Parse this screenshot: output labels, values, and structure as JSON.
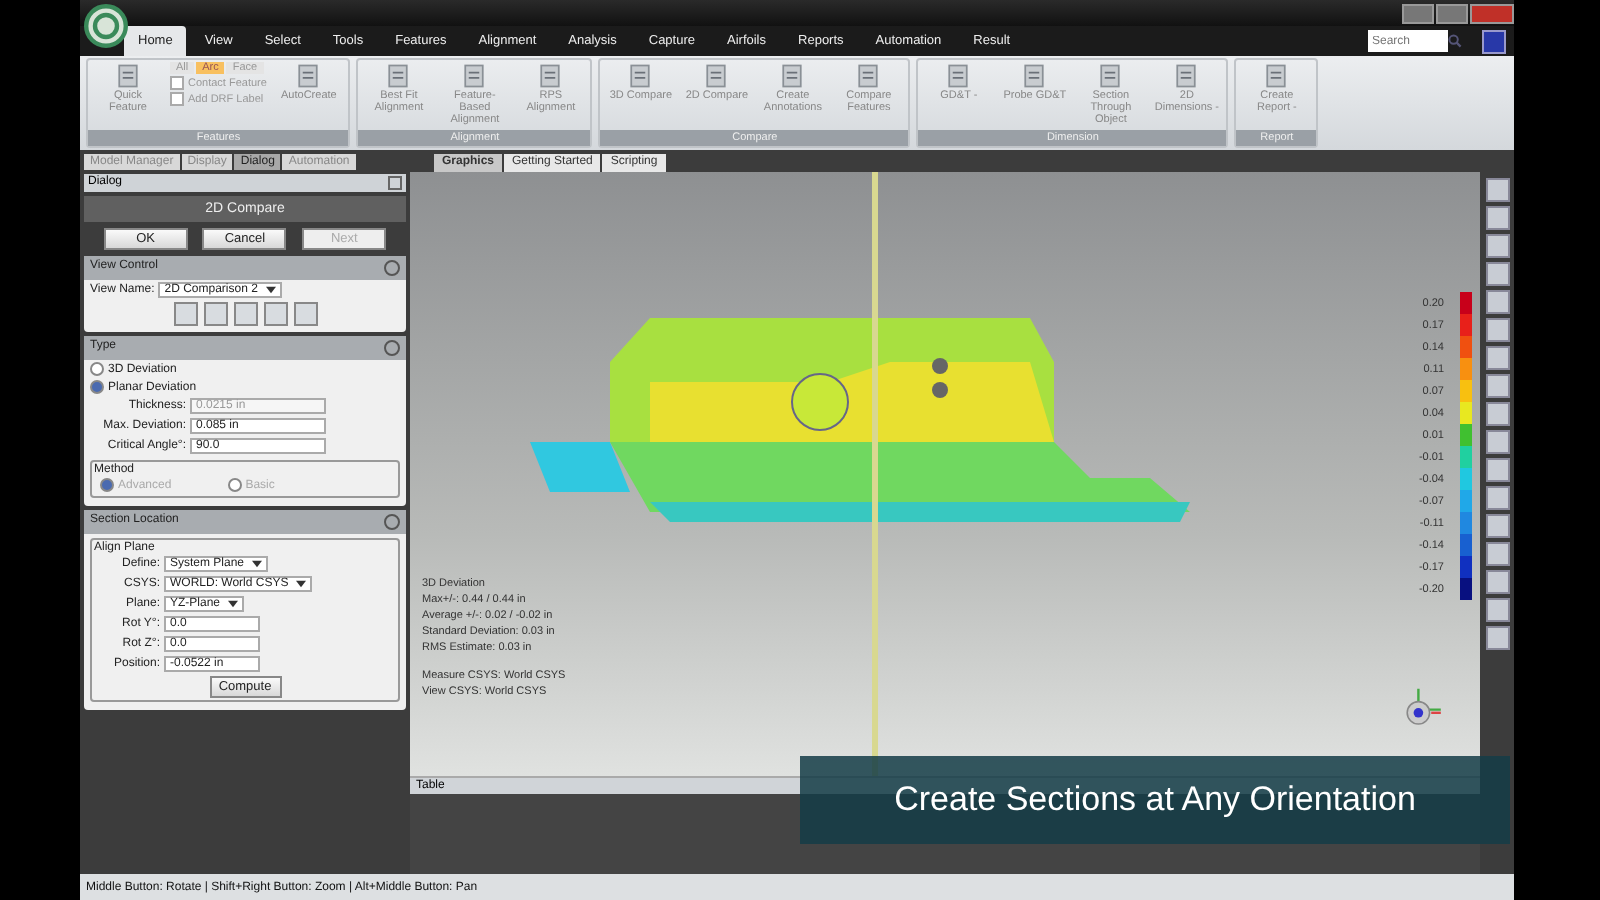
{
  "app_tabs": [
    {
      "label": "Home",
      "selected": true
    },
    {
      "label": "View",
      "selected": false
    },
    {
      "label": "Select",
      "selected": false
    },
    {
      "label": "Tools",
      "selected": false
    },
    {
      "label": "Features",
      "selected": false
    },
    {
      "label": "Alignment",
      "selected": false
    },
    {
      "label": "Analysis",
      "selected": false
    },
    {
      "label": "Capture",
      "selected": false
    },
    {
      "label": "Airfoils",
      "selected": false
    },
    {
      "label": "Reports",
      "selected": false
    },
    {
      "label": "Automation",
      "selected": false
    },
    {
      "label": "Result",
      "selected": false
    }
  ],
  "search": {
    "placeholder": "Search"
  },
  "ribbon_groups": [
    {
      "title": "Features",
      "items": [
        {
          "kind": "button",
          "label": "Quick Feature"
        },
        {
          "kind": "stack",
          "toggles": [
            {
              "label": "All",
              "selected": false
            },
            {
              "label": "Arc",
              "selected": true
            },
            {
              "label": "Face",
              "selected": false
            }
          ],
          "checks": [
            {
              "label": "Contact Feature",
              "checked": false
            },
            {
              "label": "Add DRF Label",
              "checked": false
            }
          ]
        },
        {
          "kind": "button",
          "label": "AutoCreate"
        }
      ]
    },
    {
      "title": "Alignment",
      "items": [
        {
          "kind": "button",
          "label": "Best Fit Alignment"
        },
        {
          "kind": "button",
          "label": "Feature-Based Alignment"
        },
        {
          "kind": "button",
          "label": "RPS Alignment"
        }
      ]
    },
    {
      "title": "Compare",
      "items": [
        {
          "kind": "button",
          "label": "3D Compare"
        },
        {
          "kind": "button",
          "label": "2D Compare"
        },
        {
          "kind": "button",
          "label": "Create Annotations"
        },
        {
          "kind": "button",
          "label": "Compare Features"
        }
      ]
    },
    {
      "title": "Dimension",
      "items": [
        {
          "kind": "button",
          "label": "GD&T -"
        },
        {
          "kind": "button",
          "label": "Probe GD&T"
        },
        {
          "kind": "button",
          "label": "Section Through Object"
        },
        {
          "kind": "button",
          "label": "2D Dimensions -"
        }
      ]
    },
    {
      "title": "Report",
      "items": [
        {
          "kind": "button",
          "label": "Create Report -"
        }
      ]
    }
  ],
  "panel_tabs": [
    {
      "label": "Model Manager",
      "selected": false
    },
    {
      "label": "Display",
      "selected": false
    },
    {
      "label": "Dialog",
      "selected": true
    },
    {
      "label": "Automation",
      "selected": false
    }
  ],
  "dialog": {
    "header": "Dialog",
    "title": "2D Compare",
    "buttons": [
      {
        "label": "OK",
        "disabled": false
      },
      {
        "label": "Cancel",
        "disabled": false
      },
      {
        "label": "Next",
        "disabled": true
      }
    ],
    "view_control": {
      "title": "View Control",
      "label": "View Name:",
      "value": "2D Comparison 2"
    },
    "type": {
      "title": "Type",
      "options": [
        {
          "label": "3D Deviation",
          "selected": false
        },
        {
          "label": "Planar Deviation",
          "selected": true
        }
      ],
      "fields": [
        {
          "label": "Thickness:",
          "value": "0.0215 in",
          "disabled": true
        },
        {
          "label": "Max. Deviation:",
          "value": "0.085 in",
          "disabled": false
        },
        {
          "label": "Critical Angle°:",
          "value": "90.0",
          "disabled": false
        }
      ],
      "method": {
        "title": "Method",
        "options": [
          {
            "label": "Advanced",
            "selected": true
          },
          {
            "label": "Basic",
            "selected": false
          }
        ]
      }
    },
    "section_location": {
      "title": "Section Location",
      "group": "Align Plane",
      "fields": [
        {
          "kind": "dropdown",
          "label": "Define:",
          "value": "System Plane"
        },
        {
          "kind": "dropdown",
          "label": "CSYS:",
          "value": "WORLD: World CSYS"
        },
        {
          "kind": "dropdown",
          "label": "Plane:",
          "value": "YZ-Plane"
        },
        {
          "kind": "spin",
          "label": "Rot Y°:",
          "value": "0.0"
        },
        {
          "kind": "spin",
          "label": "Rot Z°:",
          "value": "0.0"
        },
        {
          "kind": "spin",
          "label": "Position:",
          "value": "-0.0522 in"
        }
      ],
      "button": "Compute"
    }
  },
  "doc_tabs": [
    {
      "label": "Graphics",
      "selected": true
    },
    {
      "label": "Getting Started",
      "selected": false
    },
    {
      "label": "Scripting",
      "selected": false
    }
  ],
  "stats": [
    "3D Deviation",
    "Max+/-: 0.44 / 0.44 in",
    "Average +/-: 0.02 / -0.02 in",
    "Standard Deviation: 0.03 in",
    "RMS Estimate: 0.03 in"
  ],
  "csys": [
    "Measure CSYS: World CSYS",
    "View CSYS: World CSYS"
  ],
  "legend": [
    {
      "label": "0.20",
      "color": "#c8001a"
    },
    {
      "label": "0.17",
      "color": "#e8201a"
    },
    {
      "label": "0.14",
      "color": "#f05010"
    },
    {
      "label": "0.11",
      "color": "#f89010"
    },
    {
      "label": "0.07",
      "color": "#f8c010"
    },
    {
      "label": "0.04",
      "color": "#e8e820"
    },
    {
      "label": "0.01",
      "color": "#40c030"
    },
    {
      "label": "-0.01",
      "color": "#20d0a0"
    },
    {
      "label": "-0.04",
      "color": "#20c8e0"
    },
    {
      "label": "-0.07",
      "color": "#20a8e8"
    },
    {
      "label": "-0.11",
      "color": "#2088e0"
    },
    {
      "label": "-0.14",
      "color": "#1860d0"
    },
    {
      "label": "-0.17",
      "color": "#1030c0"
    },
    {
      "label": "-0.20",
      "color": "#081080"
    }
  ],
  "table_panel": {
    "title": "Table"
  },
  "caption": "Create Sections at Any Orientation",
  "status_bar": "Middle Button: Rotate | Shift+Right Button: Zoom | Alt+Middle Button: Pan"
}
